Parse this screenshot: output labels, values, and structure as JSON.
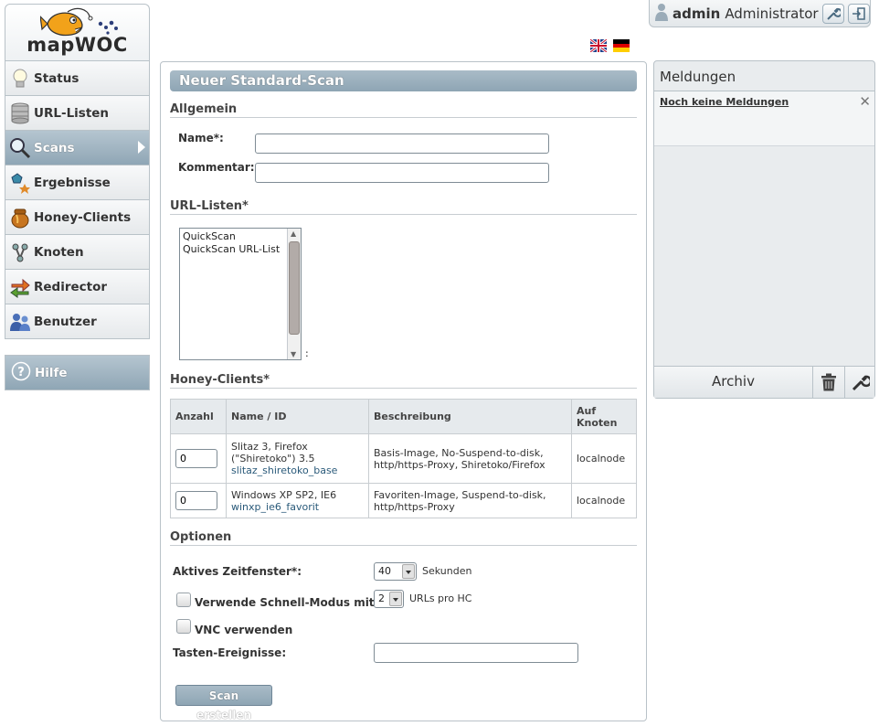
{
  "app": {
    "logo_text": "mapWOC"
  },
  "nav": {
    "items": [
      {
        "label": "Status",
        "icon": "bulb-icon"
      },
      {
        "label": "URL-Listen",
        "icon": "database-icon"
      },
      {
        "label": "Scans",
        "icon": "magnifier-icon",
        "active": true
      },
      {
        "label": "Ergebnisse",
        "icon": "results-icon"
      },
      {
        "label": "Honey-Clients",
        "icon": "honeypot-icon"
      },
      {
        "label": "Knoten",
        "icon": "nodes-icon"
      },
      {
        "label": "Redirector",
        "icon": "redirect-arrows-icon"
      },
      {
        "label": "Benutzer",
        "icon": "users-icon"
      }
    ],
    "help_label": "Hilfe"
  },
  "user": {
    "name": "admin",
    "role": "Administrator"
  },
  "colors": {
    "accent": "#8ea5b4",
    "link": "#2a5a7a"
  },
  "form": {
    "title": "Neuer Standard-Scan",
    "general": {
      "heading": "Allgemein",
      "name_label": "Name*:",
      "name_value": "",
      "comment_label": "Kommentar:",
      "comment_value": ""
    },
    "url_lists": {
      "heading": "URL-Listen*",
      "options": [
        "QuickScan",
        "QuickScan URL-List"
      ],
      "suffix": ":"
    },
    "honey_clients": {
      "heading": "Honey-Clients*",
      "columns": [
        "Anzahl",
        "Name / ID",
        "Beschreibung",
        "Auf Knoten"
      ],
      "rows": [
        {
          "count": "0",
          "name": "Slitaz 3, Firefox (\"Shiretoko\") 3.5",
          "id": "slitaz_shiretoko_base",
          "description": "Basis-Image, No-Suspend-to-disk, http/https-Proxy, Shiretoko/Firefox",
          "node": "localnode"
        },
        {
          "count": "0",
          "name": "Windows XP SP2, IE6",
          "id": "winxp_ie6_favorit",
          "description": "Favoriten-Image, Suspend-to-disk, http/https-Proxy",
          "node": "localnode"
        }
      ]
    },
    "options": {
      "heading": "Optionen",
      "window_label": "Aktives Zeitfenster*:",
      "window_value": "40",
      "window_unit": "Sekunden",
      "fastmode_label": "Verwende Schnell-Modus mit:",
      "fastmode_value": "2",
      "fastmode_unit": "URLs pro HC",
      "vnc_label": "VNC verwenden",
      "keys_label": "Tasten-Ereignisse:",
      "keys_value": ""
    },
    "submit_label": "Scan erstellen"
  },
  "messages": {
    "title": "Meldungen",
    "empty_text": "Noch keine Meldungen",
    "archive_label": "Archiv"
  }
}
